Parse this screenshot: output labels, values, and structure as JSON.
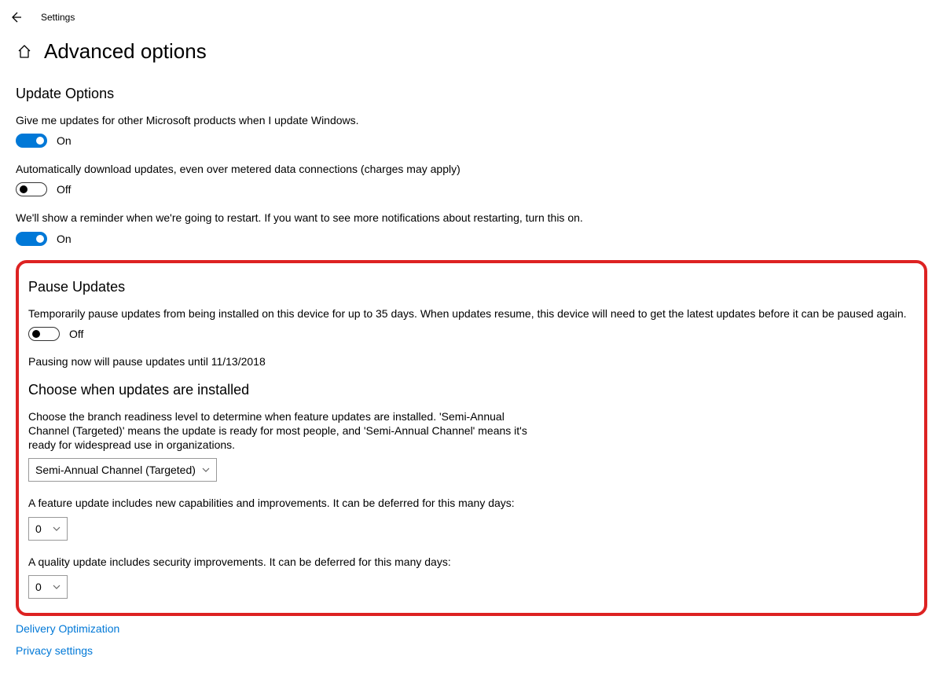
{
  "app": {
    "title": "Settings"
  },
  "page": {
    "title": "Advanced options"
  },
  "updateOptions": {
    "heading": "Update Options",
    "opt1": {
      "desc": "Give me updates for other Microsoft products when I update Windows.",
      "state": "On"
    },
    "opt2": {
      "desc": "Automatically download updates, even over metered data connections (charges may apply)",
      "state": "Off"
    },
    "opt3": {
      "desc": "We'll show a reminder when we're going to restart. If you want to see more notifications about restarting, turn this on.",
      "state": "On"
    }
  },
  "pauseUpdates": {
    "heading": "Pause Updates",
    "desc": "Temporarily pause updates from being installed on this device for up to 35 days. When updates resume, this device will need to get the latest updates before it can be paused again.",
    "state": "Off",
    "note": "Pausing now will pause updates until 11/13/2018"
  },
  "chooseWhen": {
    "heading": "Choose when updates are installed",
    "desc": "Choose the branch readiness level to determine when feature updates are installed. 'Semi-Annual Channel (Targeted)' means the update is ready for most people, and 'Semi-Annual Channel' means it's ready for widespread use in organizations.",
    "channel": "Semi-Annual Channel (Targeted)",
    "featureDesc": "A feature update includes new capabilities and improvements. It can be deferred for this many days:",
    "featureDays": "0",
    "qualityDesc": "A quality update includes security improvements. It can be deferred for this many days:",
    "qualityDays": "0"
  },
  "links": {
    "delivery": "Delivery Optimization",
    "privacy": "Privacy settings"
  }
}
